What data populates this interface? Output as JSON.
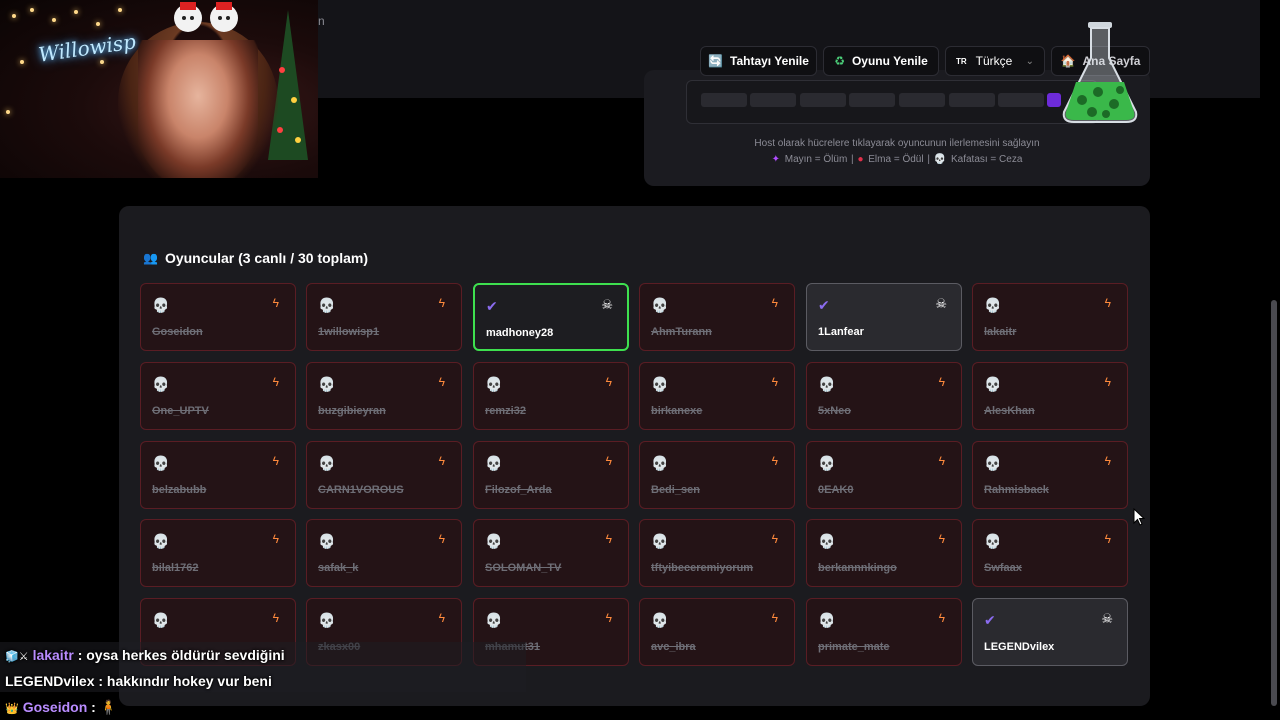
{
  "controls": {
    "refresh_board": "Tahtayı Yenile",
    "refresh_game": "Oyunu Yenile",
    "language_flag": "TR",
    "language": "Türkçe",
    "home": "Ana Sayfa"
  },
  "webcam": {
    "neon_sign": "Willowisp",
    "partial_text": "n"
  },
  "board": {
    "hint": "Host olarak hücrelere tıklayarak oyuncunun ilerlemesini sağlayın",
    "legend_mine": "Mayın = Ölüm",
    "legend_apple": "Elma = Ödül",
    "legend_skull": "Kafatası = Ceza"
  },
  "players": {
    "title": "Oyuncular (3 canlı / 30 toplam)",
    "list": [
      {
        "name": "Goseidon",
        "alive": false
      },
      {
        "name": "1willowisp1",
        "alive": false
      },
      {
        "name": "madhoney28",
        "alive": true,
        "highlight": true
      },
      {
        "name": "AhmTurann",
        "alive": false
      },
      {
        "name": "1Lanfear",
        "alive": true
      },
      {
        "name": "lakaitr",
        "alive": false
      },
      {
        "name": "One_UPTV",
        "alive": false
      },
      {
        "name": "buzgibieyran",
        "alive": false
      },
      {
        "name": "remzi32",
        "alive": false
      },
      {
        "name": "birkanexe",
        "alive": false
      },
      {
        "name": "5xNeo",
        "alive": false
      },
      {
        "name": "AlesKhan",
        "alive": false
      },
      {
        "name": "belzabubb",
        "alive": false
      },
      {
        "name": "CARN1VOROUS",
        "alive": false
      },
      {
        "name": "Filozof_Arda",
        "alive": false
      },
      {
        "name": "Bedi_sen",
        "alive": false
      },
      {
        "name": "0EAK0",
        "alive": false
      },
      {
        "name": "Rahmisback",
        "alive": false
      },
      {
        "name": "bilal1762",
        "alive": false
      },
      {
        "name": "safak_k",
        "alive": false
      },
      {
        "name": "SOLOMAN_TV",
        "alive": false
      },
      {
        "name": "tftyibeceremiyorum",
        "alive": false
      },
      {
        "name": "berkannnkingo",
        "alive": false
      },
      {
        "name": "Swfaax",
        "alive": false
      },
      {
        "name": "",
        "alive": false
      },
      {
        "name": "zkasx00",
        "alive": false
      },
      {
        "name": "mhamut31",
        "alive": false
      },
      {
        "name": "avc_ibra",
        "alive": false
      },
      {
        "name": "primate_mate",
        "alive": false
      },
      {
        "name": "LEGENDvilex",
        "alive": true
      }
    ]
  },
  "chat": [
    {
      "user": "lakaitr",
      "message": ": oysa herkes öldürür sevdiğini",
      "color": "#b98cff"
    },
    {
      "user": "LEGENDvilex",
      "message": ": hakkındır hokey vur beni",
      "color": "#ffffff"
    },
    {
      "user": "Goseidon",
      "message": ":",
      "color": "#b98cff"
    }
  ],
  "icons": {
    "dead": "skull-icon",
    "alive": "check-icon",
    "dead_action": "lightning-icon",
    "alive_action": "skull-crossbones-icon"
  }
}
